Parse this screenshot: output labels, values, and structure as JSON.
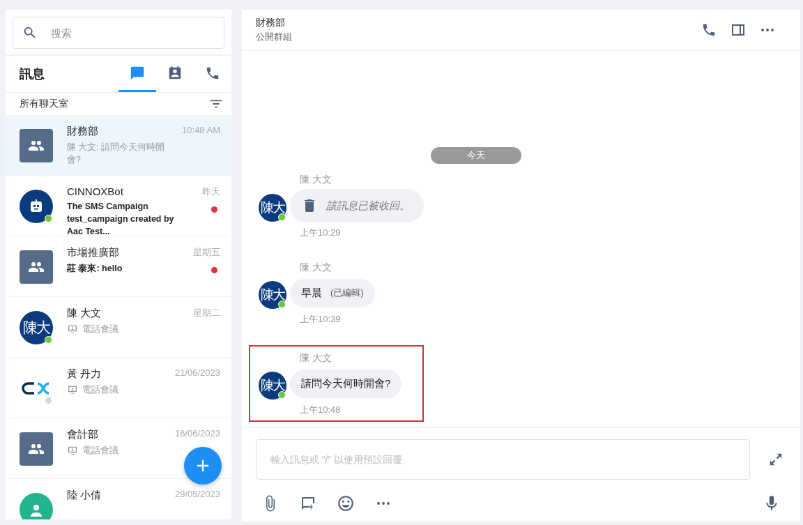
{
  "search": {
    "placeholder": "搜索"
  },
  "sidebar": {
    "title": "訊息",
    "tabs": [
      {
        "kind": "chat",
        "selected": true
      },
      {
        "kind": "contacts",
        "selected": false
      },
      {
        "kind": "calls",
        "selected": false
      }
    ],
    "filter_label": "所有聊天室"
  },
  "conversations": [
    {
      "name": "財務部",
      "time": "10:48 AM",
      "preview": {
        "kind": "text",
        "text": "陳 大文: 請問今天何時開會?"
      },
      "avatar": {
        "kind": "group"
      },
      "unread": false,
      "selected": true
    },
    {
      "name": "CINNOXBot",
      "time": "昨天",
      "preview": {
        "kind": "text",
        "text": "The SMS Campaign test_campaign created by Aac Test..."
      },
      "avatar": {
        "kind": "bot"
      },
      "online": true,
      "unread": true,
      "selected": false
    },
    {
      "name": "市場推廣部",
      "time": "星期五",
      "preview": {
        "kind": "text",
        "text": "莊 泰來: hello"
      },
      "avatar": {
        "kind": "group"
      },
      "unread": true,
      "selected": false
    },
    {
      "name": "陳 大文",
      "time": "星期二",
      "preview": {
        "kind": "call",
        "text": "電話會議"
      },
      "avatar": {
        "kind": "initials",
        "initials": "陳大"
      },
      "online": true,
      "unread": false,
      "selected": false
    },
    {
      "name": "黃 丹力",
      "time": "21/06/2023",
      "preview": {
        "kind": "call",
        "text": "電話會議"
      },
      "avatar": {
        "kind": "logo"
      },
      "online": false,
      "unread": false,
      "selected": false
    },
    {
      "name": "會計部",
      "time": "16/06/2023",
      "preview": {
        "kind": "call",
        "text": "電話會議"
      },
      "avatar": {
        "kind": "group"
      },
      "unread": false,
      "selected": false
    },
    {
      "name": "陸 小倩",
      "time": "29/05/2023",
      "avatar": {
        "kind": "person"
      },
      "unread": false,
      "selected": false
    }
  ],
  "chat": {
    "title": "財務部",
    "subtitle": "公開群組",
    "date_divider": "今天",
    "messages": [
      {
        "sender": "陳 大文",
        "initials": "陳大",
        "kind": "recalled",
        "text": "該訊息已被收回。",
        "time": "上午10:29",
        "highlighted": false
      },
      {
        "sender": "陳 大文",
        "initials": "陳大",
        "kind": "text",
        "text": "早晨",
        "edited_tag": "(已編輯)",
        "time": "上午10:39",
        "highlighted": false
      },
      {
        "sender": "陳 大文",
        "initials": "陳大",
        "kind": "text",
        "text": "請問今天何時開會?",
        "time": "上午10:48",
        "highlighted": true
      }
    ],
    "composer": {
      "placeholder": "輸入訊息或 “/” 以使用預設回覆"
    }
  }
}
